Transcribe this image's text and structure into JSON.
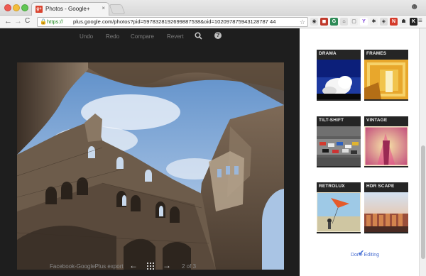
{
  "browser": {
    "tab_title": "Photos - Google+",
    "tab_close": "×",
    "favicon_text": "g+",
    "url_scheme": "https://",
    "url_rest": "plus.google.com/photos?pid=5978328192699887538&oid=102097875943128787 44",
    "nav_back": "←",
    "nav_forward": "→",
    "nav_reload": "C"
  },
  "editor": {
    "toolbar": {
      "undo": "Undo",
      "redo": "Redo",
      "compare": "Compare",
      "revert": "Revert",
      "help": "?"
    },
    "footer": {
      "album": "Facebook-GooglePlus export",
      "prev": "←",
      "next": "→",
      "page": "2 of 3"
    }
  },
  "filters": [
    {
      "label": "DRAMA"
    },
    {
      "label": "FRAMES"
    },
    {
      "label": "TILT-SHIFT"
    },
    {
      "label": "VINTAGE"
    },
    {
      "label": "RETROLUX"
    },
    {
      "label": "HDR SCAPE"
    }
  ],
  "panel": {
    "done_label": "Done Editing"
  },
  "colors": {
    "accent": "#3d6bd6",
    "editor_bg": "#1e1e1e",
    "google_red": "#d9432f"
  }
}
